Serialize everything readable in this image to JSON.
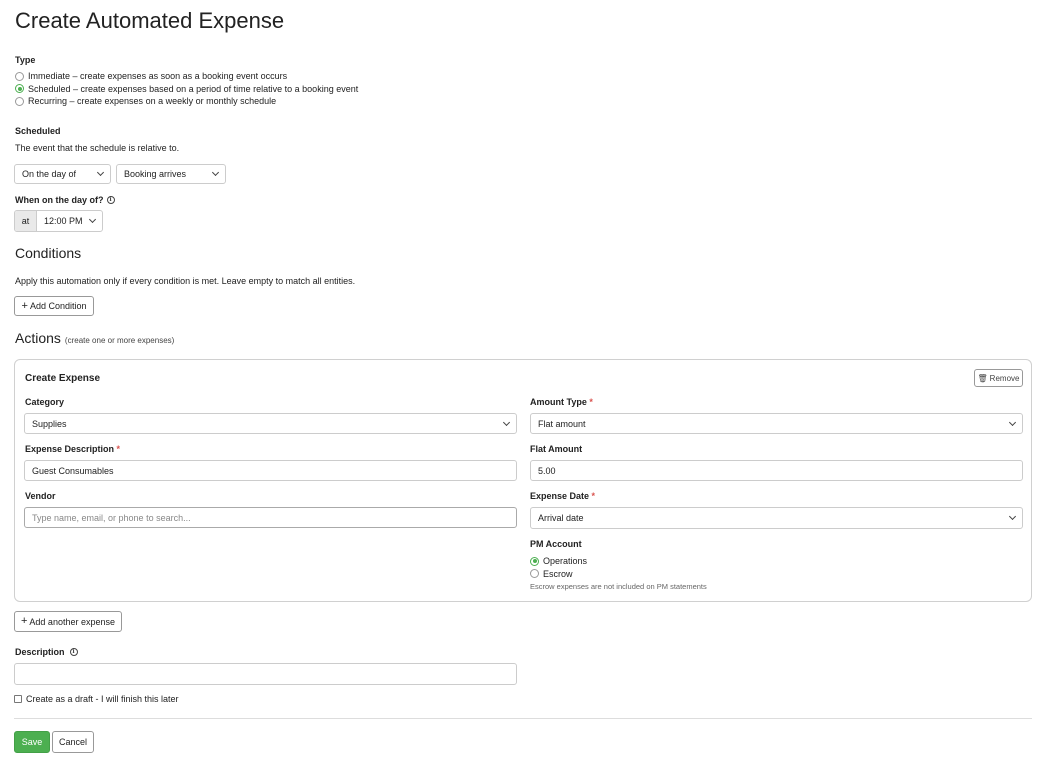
{
  "page": {
    "title": "Create Automated Expense"
  },
  "type_section": {
    "label": "Type",
    "options": [
      {
        "label": "Immediate – create expenses as soon as a booking event occurs",
        "checked": false
      },
      {
        "label": "Scheduled – create expenses based on a period of time relative to a booking event",
        "checked": true
      },
      {
        "label": "Recurring – create expenses on a weekly or monthly schedule",
        "checked": false
      }
    ]
  },
  "scheduled": {
    "label": "Scheduled",
    "help": "The event that the schedule is relative to.",
    "offset_select": "On the day of",
    "event_select": "Booking arrives",
    "when_label": "When on the day of?",
    "at_label": "at",
    "time_select": "12:00 PM"
  },
  "conditions": {
    "heading": "Conditions",
    "help": "Apply this automation only if every condition is met. Leave empty to match all entities.",
    "add_button": "Add Condition"
  },
  "actions": {
    "heading": "Actions",
    "subheading": "(create one or more expenses)",
    "card": {
      "title": "Create Expense",
      "remove_button": "Remove",
      "category_label": "Category",
      "category_value": "Supplies",
      "amount_type_label": "Amount Type",
      "amount_type_value": "Flat amount",
      "description_label": "Expense Description",
      "description_value": "Guest Consumables",
      "flat_amount_label": "Flat Amount",
      "flat_amount_value": "5.00",
      "vendor_label": "Vendor",
      "vendor_placeholder": "Type name, email, or phone to search...",
      "expense_date_label": "Expense Date",
      "expense_date_value": "Arrival date",
      "pm_account_label": "PM Account",
      "pm_options": [
        {
          "label": "Operations",
          "checked": true
        },
        {
          "label": "Escrow",
          "checked": false
        }
      ],
      "pm_note": "Escrow expenses are not included on PM statements",
      "required_mark": "*"
    },
    "add_another_button": "Add another expense"
  },
  "description": {
    "label": "Description",
    "value": ""
  },
  "draft_checkbox": {
    "label": "Create as a draft - I will finish this later",
    "checked": false
  },
  "footer": {
    "save": "Save",
    "cancel": "Cancel"
  },
  "colors": {
    "accent": "#4caf50",
    "required": "#d9534f",
    "border": "#cccccc"
  }
}
